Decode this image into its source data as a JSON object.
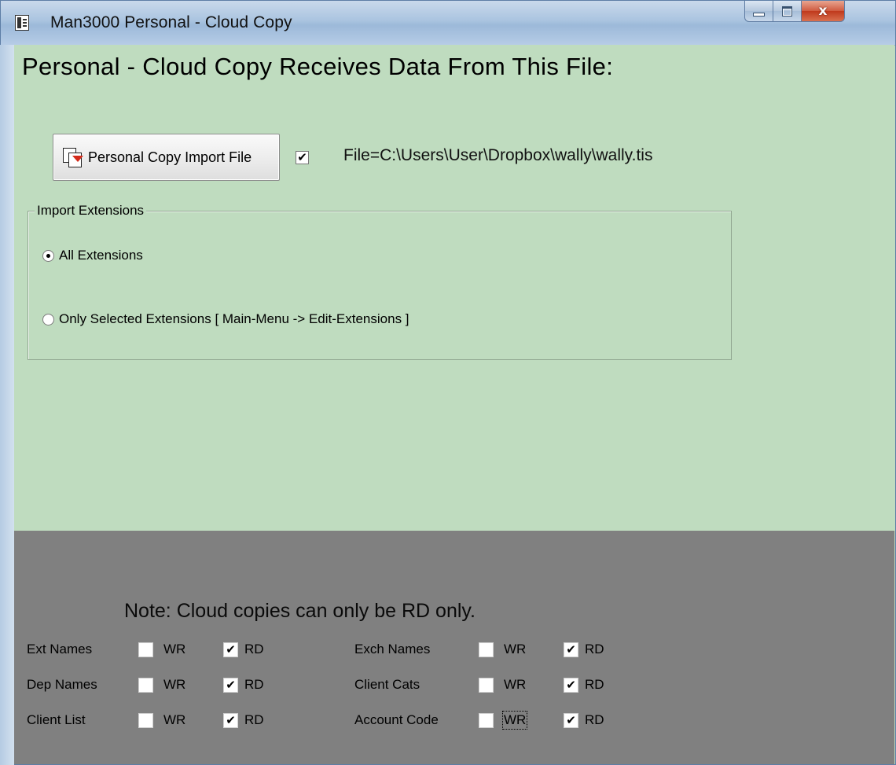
{
  "window": {
    "title": "Man3000 Personal - Cloud Copy",
    "close_symbol": "x"
  },
  "heading": "Personal - Cloud Copy Receives Data From This File:",
  "import_button": {
    "label": "Personal Copy Import File",
    "icon": "import-file-icon"
  },
  "import_checked": true,
  "file_path": "File=C:\\Users\\User\\Dropbox\\wally\\wally.tis",
  "extensions": {
    "legend": "Import Extensions",
    "options": [
      {
        "label": "All Extensions",
        "selected": true
      },
      {
        "label": "Only Selected Extensions [ Main-Menu -> Edit-Extensions ]",
        "selected": false
      }
    ]
  },
  "note": "Note: Cloud copies can only be RD only.",
  "permissions": {
    "wr_label": "WR",
    "rd_label": "RD",
    "rows": [
      {
        "name": "Ext Names",
        "wr": false,
        "rd": true
      },
      {
        "name": "Dep Names",
        "wr": false,
        "rd": true
      },
      {
        "name": "Client List",
        "wr": false,
        "rd": true
      },
      {
        "name": "Exch Names",
        "wr": false,
        "rd": true
      },
      {
        "name": "Client Cats",
        "wr": false,
        "rd": true
      },
      {
        "name": "Account Code",
        "wr": false,
        "rd": true
      }
    ]
  },
  "colors": {
    "panel": "#bfdcbf",
    "lower_panel": "#808080"
  }
}
